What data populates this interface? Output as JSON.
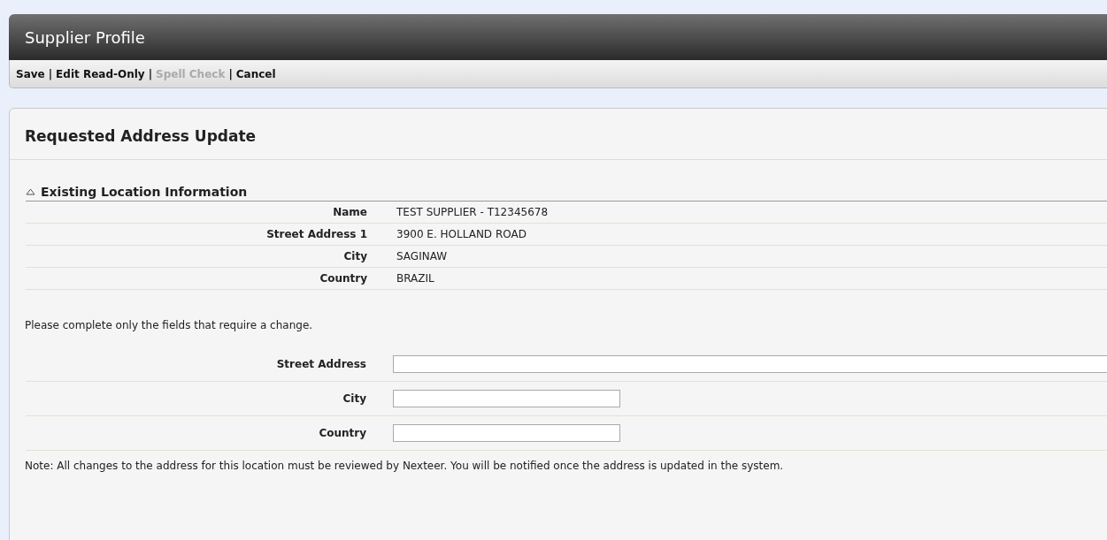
{
  "window": {
    "title": "Supplier Profile"
  },
  "toolbar": [
    {
      "kind": "action",
      "label": "Save",
      "disabled": false
    },
    {
      "kind": "separator",
      "label": "|"
    },
    {
      "kind": "action",
      "label": "Edit Read-Only",
      "disabled": false
    },
    {
      "kind": "separator",
      "label": "|"
    },
    {
      "kind": "action",
      "label": "Spell Check",
      "disabled": true
    },
    {
      "kind": "separator",
      "label": "|"
    },
    {
      "kind": "action",
      "label": "Cancel",
      "disabled": false
    }
  ],
  "panel": {
    "title": "Requested Address Update",
    "section": {
      "title": "Existing Location Information",
      "expanded": true,
      "rows": [
        {
          "label": "Name",
          "value": "TEST SUPPLIER - T12345678"
        },
        {
          "label": "Street Address 1",
          "value": "3900 E. HOLLAND ROAD"
        },
        {
          "label": "City",
          "value": "SAGINAW"
        },
        {
          "label": "Country",
          "value": "BRAZIL"
        }
      ]
    },
    "instructions": "Please complete only the fields that require a change.",
    "fields": [
      {
        "label": "Street Address",
        "kind": "wide"
      },
      {
        "label": "City",
        "kind": "short"
      },
      {
        "label": "Country",
        "kind": "short"
      }
    ],
    "note": "Note: All changes to the address for this location must be reviewed by Nexteer. You will be notified once the address is updated in the system."
  }
}
